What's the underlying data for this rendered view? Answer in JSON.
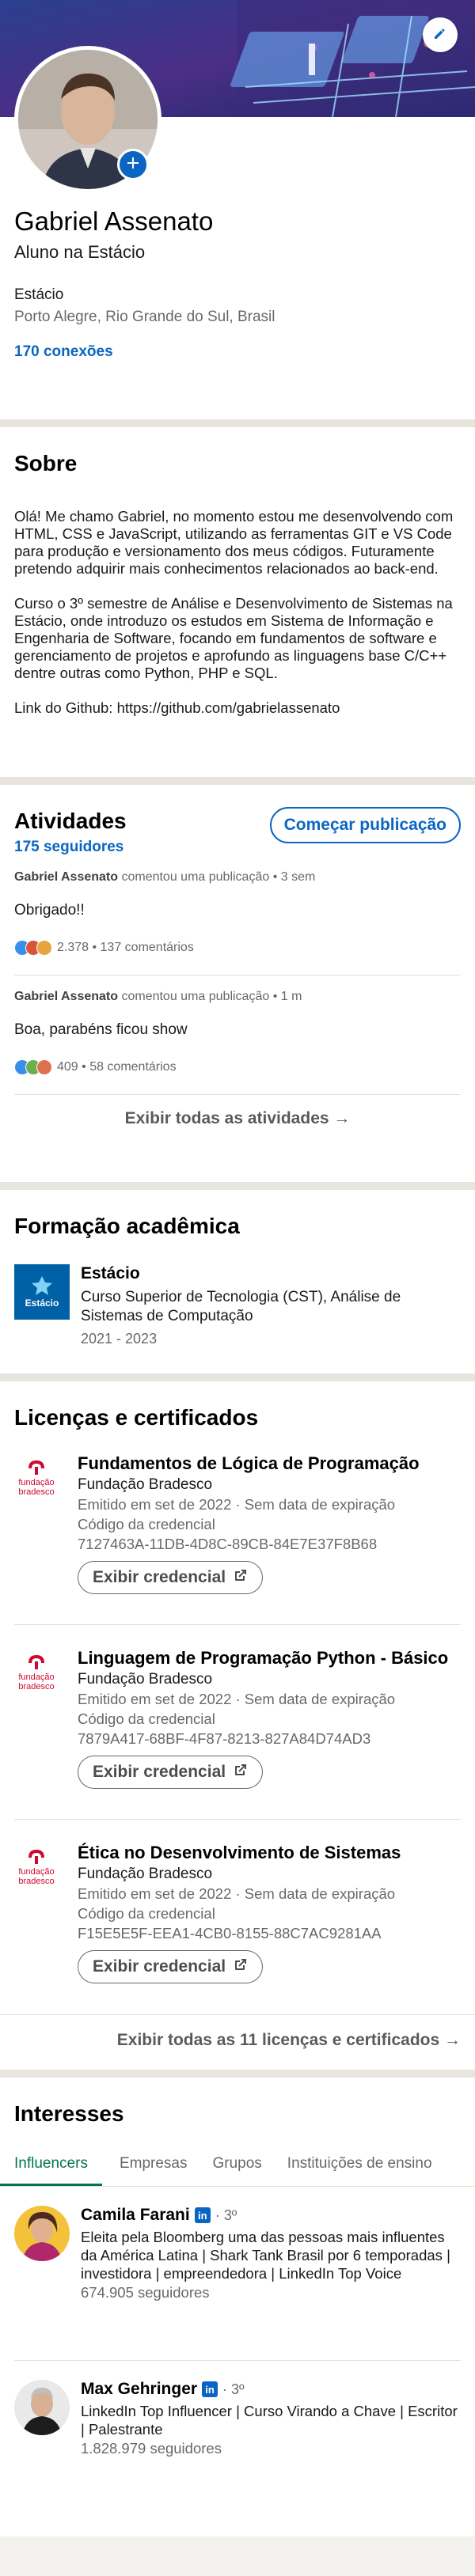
{
  "profile": {
    "name": "Gabriel Assenato",
    "headline": "Aluno na Estácio",
    "organization": "Estácio",
    "location": "Porto Alegre, Rio Grande do Sul, Brasil",
    "connections": "170 conexões"
  },
  "about": {
    "title": "Sobre",
    "paragraphs": [
      "Olá! Me chamo Gabriel,  no momento estou me desenvolvendo com HTML, CSS e JavaScript, utilizando as ferramentas GIT e VS Code para produção e versionamento dos meus códigos. Futuramente pretendo adquirir mais conhecimentos relacionados ao back-end.",
      "Curso o 3º semestre de Análise e Desenvolvimento de Sistemas na Estácio, onde introduzo os estudos em Sistema de Informação e Engenharia de Software, focando em fundamentos de software e gerenciamento de projetos e aprofundo as linguagens base C/C++ dentre outras como Python, PHP e SQL.",
      "Link do Github: https://github.com/gabrielassenato"
    ]
  },
  "activity": {
    "title": "Atividades",
    "followers": "175 seguidores",
    "start_post_label": "Começar publicação",
    "posts": [
      {
        "author": "Gabriel Assenato",
        "action": " comentou uma publicação • 3 sem",
        "text": "Obrigado!!",
        "stats": "2.378 • 137 comentários"
      },
      {
        "author": "Gabriel Assenato",
        "action": " comentou uma publicação • 1 m",
        "text": "Boa, parabéns ficou show",
        "stats": "409 • 58 comentários"
      }
    ],
    "show_all_label": "Exibir todas as atividades →"
  },
  "education": {
    "title": "Formação acadêmica",
    "items": [
      {
        "school": "Estácio",
        "logo_text": "Estácio",
        "degree": "Curso Superior de Tecnologia (CST), Análise de Sistemas de Computação",
        "dates": "2021 - 2023"
      }
    ]
  },
  "licenses": {
    "title": "Licenças e certificados",
    "logo_text_1": "fundação",
    "logo_text_2": "bradesco",
    "items": [
      {
        "name": "Fundamentos de Lógica de Programação",
        "issuer": "Fundação Bradesco",
        "issued": "Emitido em set de 2022 · Sem data de expiração",
        "credential_label": "Código da credencial",
        "credential_id": "7127463A-11DB-4D8C-89CB-84E7E37F8B68",
        "button_label": "Exibir credencial"
      },
      {
        "name": "Linguagem de Programação Python - Básico",
        "issuer": "Fundação Bradesco",
        "issued": "Emitido em set de 2022 · Sem data de expiração",
        "credential_label": "Código da credencial",
        "credential_id": "7879A417-68BF-4F87-8213-827A84D74AD3",
        "button_label": "Exibir credencial"
      },
      {
        "name": "Ética no Desenvolvimento de Sistemas",
        "issuer": "Fundação Bradesco",
        "issued": "Emitido em set de 2022 · Sem data de expiração",
        "credential_label": "Código da credencial",
        "credential_id": "F15E5E5F-EEA1-4CB0-8155-88C7AC9281AA",
        "button_label": "Exibir credencial"
      }
    ],
    "show_all_label": "Exibir todas as 11 licenças e certificados →"
  },
  "interests": {
    "title": "Interesses",
    "tabs": [
      "Influencers",
      "Empresas",
      "Grupos",
      "Instituições de ensino"
    ],
    "people": [
      {
        "name": "Camila Farani",
        "badge": "in",
        "degree": "· 3º",
        "description": "Eleita pela Bloomberg uma das pessoas mais influentes da América Latina | Shark Tank Brasil por 6 temporadas | investidora | empreendedora | LinkedIn Top Voice",
        "followers": "674.905 seguidores"
      },
      {
        "name": "Max Gehringer",
        "badge": "in",
        "degree": "· 3º",
        "description": "LinkedIn Top Influencer | Curso Virando a Chave | Escritor | Palestrante",
        "followers": "1.828.979 seguidores"
      }
    ]
  },
  "colors": {
    "brand_blue": "#0a66c2",
    "active_tab_green": "#01754f",
    "bradesco_red": "#cc092f",
    "estacio_blue": "#0061a6"
  }
}
